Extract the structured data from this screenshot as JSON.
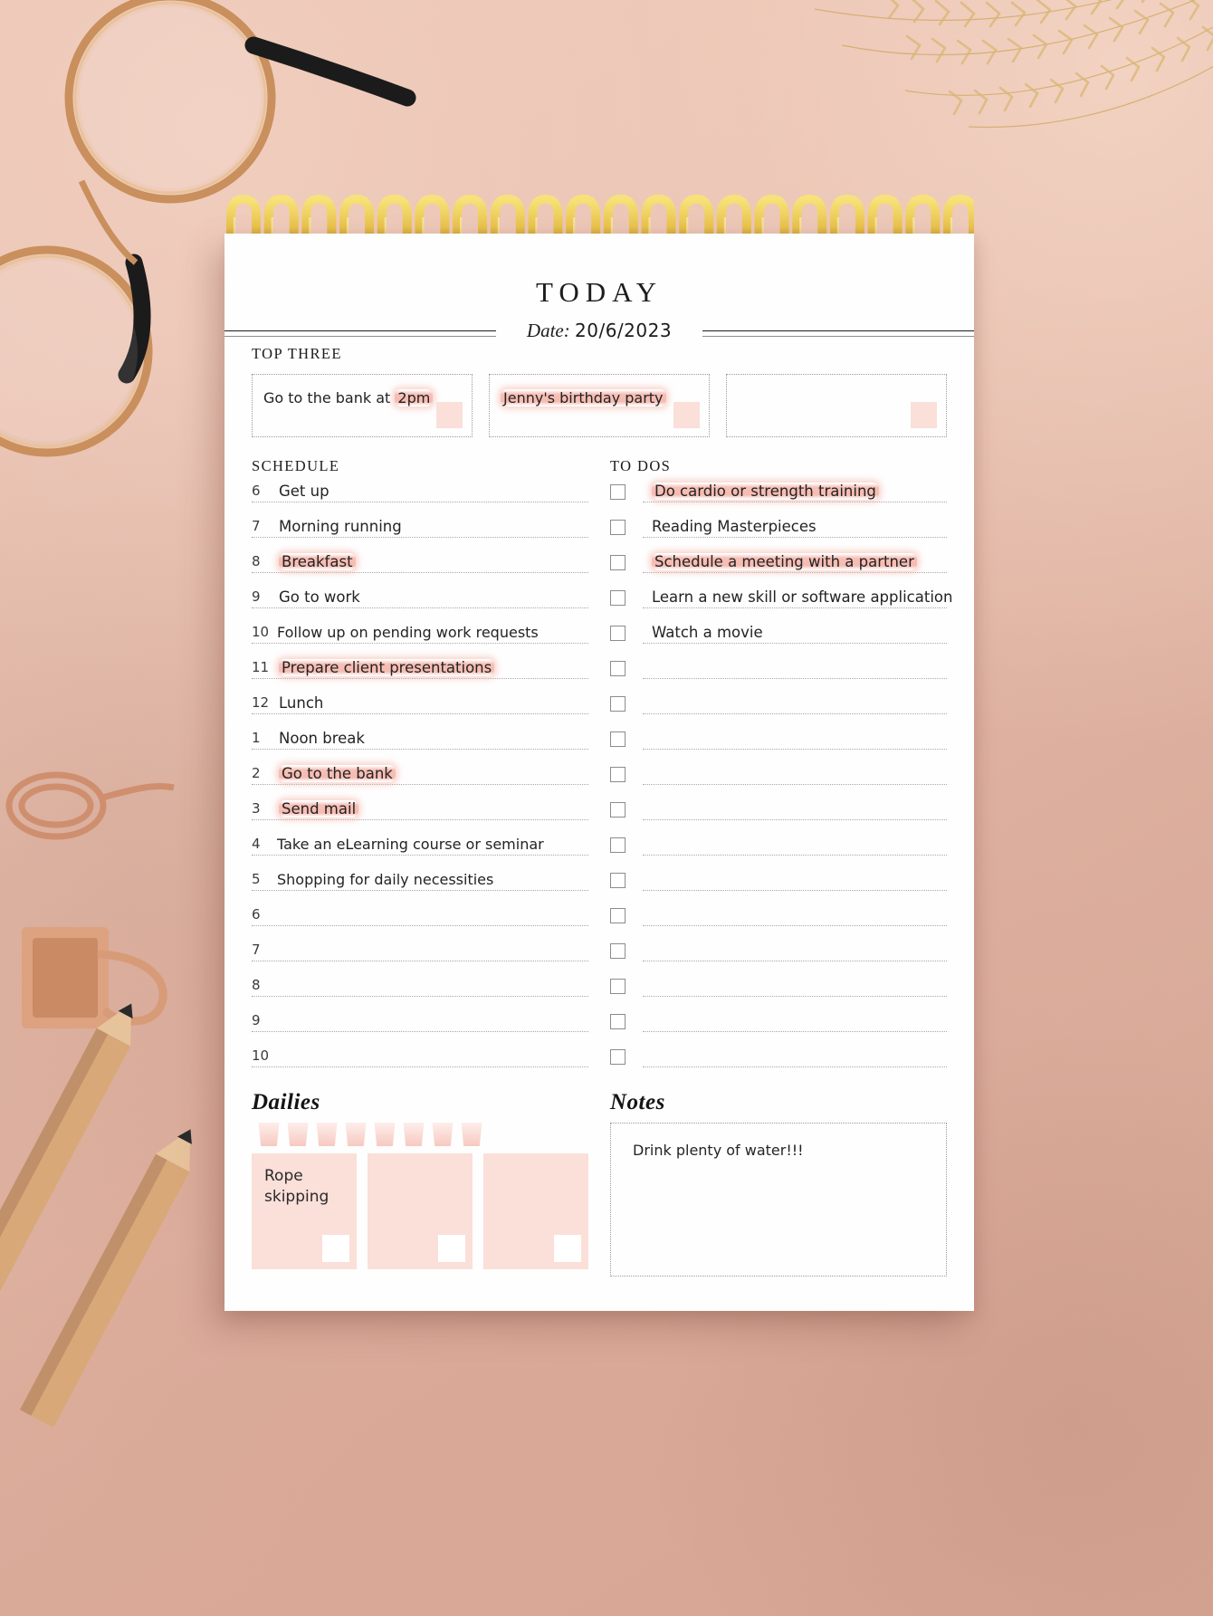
{
  "page": {
    "title": "TODAY",
    "date_label": "Date:",
    "date_value": "20/6/2023"
  },
  "top_three": {
    "heading": "TOP THREE",
    "items": [
      {
        "text_plain": "Go to the bank at ",
        "text_highlight": "2pm",
        "checked": false
      },
      {
        "text_plain": "",
        "text_highlight": "Jenny's birthday party",
        "checked": false
      },
      {
        "text_plain": "",
        "text_highlight": "",
        "checked": false
      }
    ]
  },
  "schedule": {
    "heading": "SCHEDULE",
    "rows": [
      {
        "num": "6",
        "text": "Get up",
        "highlight": false
      },
      {
        "num": "7",
        "text": "Morning running",
        "highlight": false
      },
      {
        "num": "8",
        "text": "Breakfast",
        "highlight": true
      },
      {
        "num": "9",
        "text": "Go to work",
        "highlight": false
      },
      {
        "num": "10",
        "text": "Follow up on pending work requests",
        "highlight": false
      },
      {
        "num": "11",
        "text": "Prepare client presentations",
        "highlight": true
      },
      {
        "num": "12",
        "text": "Lunch",
        "highlight": false
      },
      {
        "num": "1",
        "text": "Noon break",
        "highlight": false
      },
      {
        "num": "2",
        "text": "Go to the bank",
        "highlight": true
      },
      {
        "num": "3",
        "text": "Send mail",
        "highlight": true
      },
      {
        "num": "4",
        "text": "Take an eLearning course or seminar",
        "highlight": false
      },
      {
        "num": "5",
        "text": "Shopping for daily necessities",
        "highlight": false
      },
      {
        "num": "6",
        "text": "",
        "highlight": false
      },
      {
        "num": "7",
        "text": "",
        "highlight": false
      },
      {
        "num": "8",
        "text": "",
        "highlight": false
      },
      {
        "num": "9",
        "text": "",
        "highlight": false
      },
      {
        "num": "10",
        "text": "",
        "highlight": false
      }
    ]
  },
  "todos": {
    "heading": "TO DOS",
    "rows": [
      {
        "text": "Do cardio or strength training",
        "checked": false,
        "highlight": true
      },
      {
        "text": "Reading Masterpieces",
        "checked": false,
        "highlight": false
      },
      {
        "text": "Schedule a meeting with a partner",
        "checked": false,
        "highlight": true
      },
      {
        "text": "Learn a new skill or software application",
        "checked": false,
        "highlight": false
      },
      {
        "text": "Watch a movie",
        "checked": false,
        "highlight": false
      },
      {
        "text": "",
        "checked": false,
        "highlight": false
      },
      {
        "text": "",
        "checked": false,
        "highlight": false
      },
      {
        "text": "",
        "checked": false,
        "highlight": false
      },
      {
        "text": "",
        "checked": false,
        "highlight": false
      },
      {
        "text": "",
        "checked": false,
        "highlight": false
      },
      {
        "text": "",
        "checked": false,
        "highlight": false
      },
      {
        "text": "",
        "checked": false,
        "highlight": false
      },
      {
        "text": "",
        "checked": false,
        "highlight": false
      },
      {
        "text": "",
        "checked": false,
        "highlight": false
      },
      {
        "text": "",
        "checked": false,
        "highlight": false
      },
      {
        "text": "",
        "checked": false,
        "highlight": false
      },
      {
        "text": "",
        "checked": false,
        "highlight": false
      }
    ]
  },
  "dailies": {
    "heading": "Dailies",
    "water_glasses": 8,
    "boxes": [
      {
        "label": "Rope\nskipping",
        "checked": false
      },
      {
        "label": "",
        "checked": false
      },
      {
        "label": "",
        "checked": false
      }
    ]
  },
  "notes": {
    "heading": "Notes",
    "text": "Drink plenty of water!!!"
  },
  "colors": {
    "paper": "#fefefe",
    "highlight_pink": "#f4a89b",
    "soft_pink": "#fbdfd9",
    "desk": "#e2b5a5",
    "ink": "#232323"
  }
}
